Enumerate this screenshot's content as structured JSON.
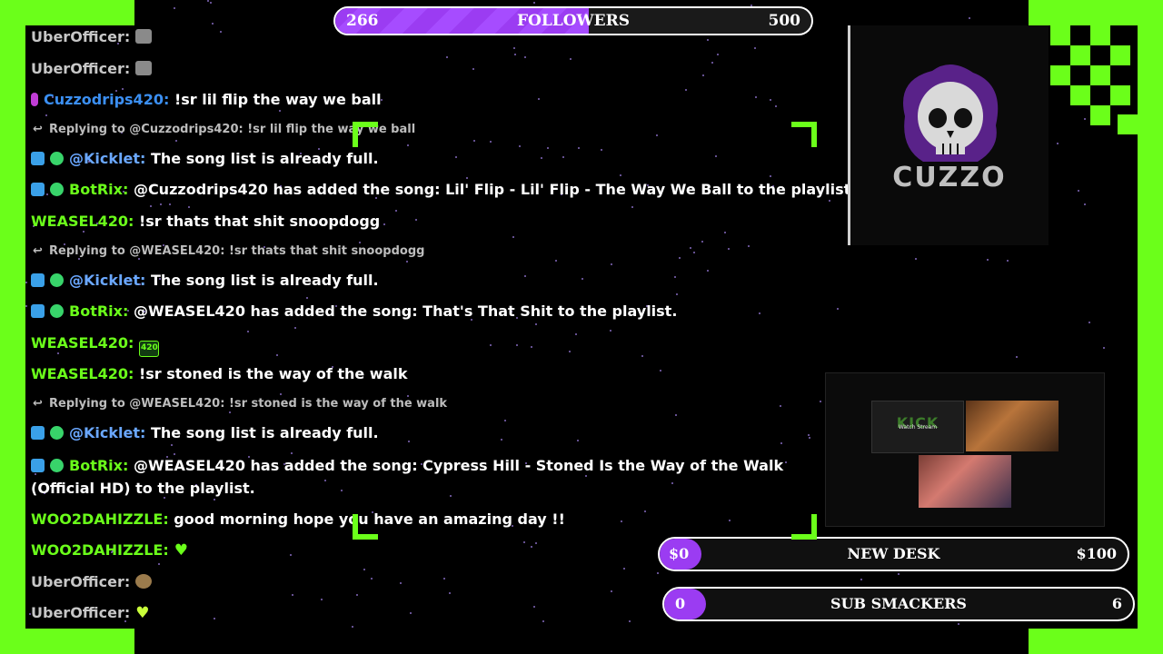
{
  "followers_bar": {
    "left_value": "266",
    "title": "FOLLOWERS",
    "right_value": "500",
    "progress": 0.532
  },
  "goals": [
    {
      "left_value": "$0",
      "label": "NEW DESK",
      "right_value": "$100",
      "progress": 0
    },
    {
      "left_value": "0",
      "label": "SUB SMACKERS",
      "right_value": "6",
      "progress": 0
    }
  ],
  "logo": {
    "text": "CUZZO"
  },
  "webcam": {
    "thumb_brand": "KICK",
    "thumb_caption": "Watch Stream"
  },
  "chat": {
    "messages": [
      {
        "user": "UberOfficer:",
        "text": "",
        "emote": "coffee-emote"
      },
      {
        "user": "UberOfficer:",
        "text": "",
        "emote": "coffee-emote"
      },
      {
        "user": "Cuzzodrips420:",
        "text": "!sr lil flip the way we ball",
        "badge": "mic"
      },
      {
        "reply": "Replying to @Cuzzodrips420: !sr lil flip the way we ball"
      },
      {
        "user": "@Kicklet:",
        "text": "The song list is already full."
      },
      {
        "user": "BotRix:",
        "text": "@Cuzzodrips420 has added the song: Lil' Flip - Lil' Flip - The Way We Ball to the playlist."
      },
      {
        "user": "WEASEL420:",
        "text": "!sr thats that shit snoopdogg"
      },
      {
        "reply": "Replying to @WEASEL420: !sr thats that shit snoopdogg"
      },
      {
        "user": "@Kicklet:",
        "text": "The song list is already full."
      },
      {
        "user": "BotRix:",
        "text": "@WEASEL420 has added the song: That's That Shit to the playlist."
      },
      {
        "user": "WEASEL420:",
        "text": "",
        "emote_text": "420"
      },
      {
        "user": "WEASEL420:",
        "text": "!sr stoned is the way of the walk"
      },
      {
        "reply": "Replying to @WEASEL420: !sr stoned is the way of the walk"
      },
      {
        "user": "@Kicklet:",
        "text": "The song list is already full."
      },
      {
        "user": "BotRix:",
        "text": "@WEASEL420 has added the song: Cypress Hill - Stoned Is the Way of the Walk (Official HD) to the playlist."
      },
      {
        "user": "WOO2DAHIZZLE:",
        "text": "good morning hope you have an amazing day !!"
      },
      {
        "user": "WOO2DAHIZZLE:",
        "text": "",
        "emote": "green-heart-emote"
      },
      {
        "user": "UberOfficer:",
        "text": "",
        "emote": "viking-emote"
      },
      {
        "user": "UberOfficer:",
        "text": "",
        "emote_text": "💚"
      }
    ]
  },
  "colors": {
    "frame_green": "#6bff1a",
    "accent_purple": "#9b3cf2",
    "kick_blue": "#6aa7ff",
    "cuzzo_blue": "#3b8ff2"
  }
}
